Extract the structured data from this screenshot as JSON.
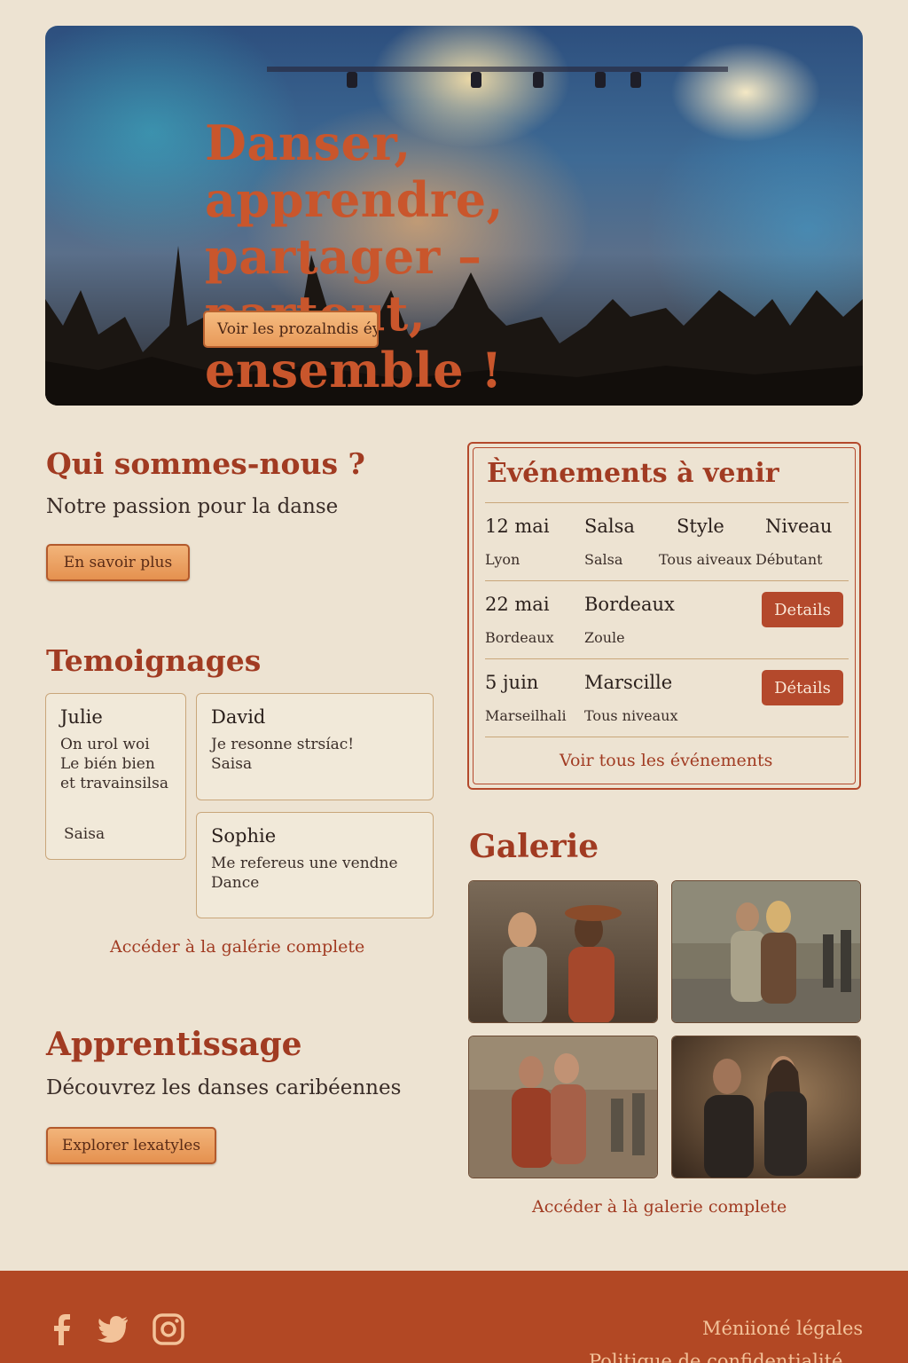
{
  "hero": {
    "title": "Danser, apprendre, partager – partout, ensemble !",
    "button_label": "Voir les prozalndis éy"
  },
  "about": {
    "title": "Qui sommes-nous ?",
    "subtitle": "Notre passion pour la danse",
    "button_label": "En savoir plus"
  },
  "testimonials": {
    "title": "Temoignages",
    "items": [
      {
        "name": "Julie",
        "text": "On urol woi\nLe bién bien et travainsilsa",
        "tag": "Saisa"
      },
      {
        "name": "David",
        "text": "Je resonne strsíac!\nSaisa",
        "tag": ""
      },
      {
        "name": "Sophie",
        "text": "Me refereus une vendne Dance",
        "tag": ""
      }
    ],
    "link": "Accéder à la galérie complete"
  },
  "learning": {
    "title": "Apprentissage",
    "subtitle": "Découvrez les danses caribéennes",
    "button_label": "Explorer lexatyles"
  },
  "events": {
    "title": "Èvénements à venir",
    "rows": [
      {
        "c1": "12 mai",
        "s1": "Lyon",
        "c2": "Salsa",
        "s2": "Salsa",
        "c3": "Style",
        "s3": "Tous aiveaux",
        "c4": "Niveau",
        "s4": "Débutant"
      },
      {
        "c1": "22 mai",
        "s1": "Bordeaux",
        "c2": "Bordeaux",
        "s2": "Zoule",
        "button": "Details"
      },
      {
        "c1": "5 juin",
        "s1": "Marseilhali",
        "c2": "Marscille",
        "s2": "Tous niveaux",
        "button": "Détails"
      }
    ],
    "link": "Voir tous les événements"
  },
  "gallery": {
    "title": "Galerie",
    "link": "Accéder à là galerie complete"
  },
  "footer": {
    "legal": "Méniioné légales",
    "privacy": "Politique de confidentialité",
    "social": [
      "facebook-icon",
      "twitter-icon",
      "instagram-icon"
    ]
  }
}
